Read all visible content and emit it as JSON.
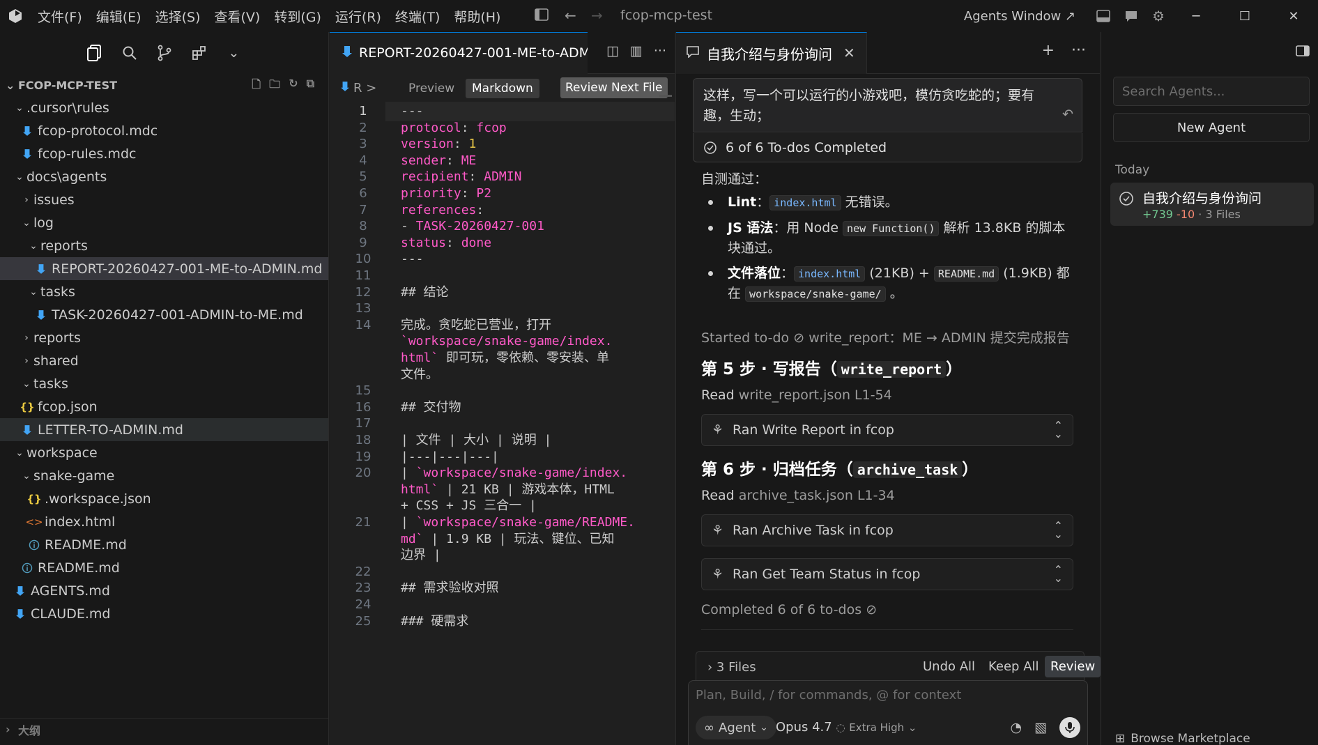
{
  "titlebar": {
    "menu": [
      "文件(F)",
      "编辑(E)",
      "选择(S)",
      "查看(V)",
      "转到(G)",
      "运行(R)",
      "终端(T)",
      "帮助(H)"
    ],
    "title": "fcop-mcp-test",
    "agents_window": "Agents Window ↗"
  },
  "explorer": {
    "root": "FCOP-MCP-TEST",
    "rows": [
      {
        "label": ".cursor\\rules",
        "indent": 1,
        "kind": "folder-open"
      },
      {
        "label": "fcop-protocol.mdc",
        "indent": 2,
        "kind": "md"
      },
      {
        "label": "fcop-rules.mdc",
        "indent": 2,
        "kind": "md"
      },
      {
        "label": "docs\\agents",
        "indent": 1,
        "kind": "folder-open"
      },
      {
        "label": "issues",
        "indent": 2,
        "kind": "folder"
      },
      {
        "label": "log",
        "indent": 2,
        "kind": "folder-open"
      },
      {
        "label": "reports",
        "indent": 3,
        "kind": "folder-open"
      },
      {
        "label": "REPORT-20260427-001-ME-to-ADMIN.md",
        "indent": 4,
        "kind": "md",
        "selected": true
      },
      {
        "label": "tasks",
        "indent": 3,
        "kind": "folder-open"
      },
      {
        "label": "TASK-20260427-001-ADMIN-to-ME.md",
        "indent": 4,
        "kind": "md"
      },
      {
        "label": "reports",
        "indent": 2,
        "kind": "folder"
      },
      {
        "label": "shared",
        "indent": 2,
        "kind": "folder"
      },
      {
        "label": "tasks",
        "indent": 2,
        "kind": "folder-open"
      },
      {
        "label": "fcop.json",
        "indent": 2,
        "kind": "json"
      },
      {
        "label": "LETTER-TO-ADMIN.md",
        "indent": 2,
        "kind": "md",
        "selected2": true
      },
      {
        "label": "workspace",
        "indent": 1,
        "kind": "folder-open"
      },
      {
        "label": "snake-game",
        "indent": 2,
        "kind": "folder-open"
      },
      {
        "label": ".workspace.json",
        "indent": 3,
        "kind": "json"
      },
      {
        "label": "index.html",
        "indent": 3,
        "kind": "html"
      },
      {
        "label": "README.md",
        "indent": 3,
        "kind": "info"
      },
      {
        "label": "README.md",
        "indent": 2,
        "kind": "info"
      },
      {
        "label": "AGENTS.md",
        "indent": 1,
        "kind": "md"
      },
      {
        "label": "CLAUDE.md",
        "indent": 1,
        "kind": "md"
      }
    ],
    "outline": "大纲"
  },
  "editor": {
    "tab_title": "REPORT-20260427-001-ME-to-ADMI",
    "crumb": "R >",
    "preview": "Preview",
    "markdown": "Markdown",
    "review_next": "Review Next File",
    "lines": [
      {
        "n": "1",
        "parts": [
          {
            "t": "---",
            "c": "plain"
          }
        ]
      },
      {
        "n": "2",
        "parts": [
          {
            "t": "protocol",
            "c": "k"
          },
          {
            "t": ": ",
            "c": "plain"
          },
          {
            "t": "fcop",
            "c": "k"
          }
        ]
      },
      {
        "n": "3",
        "parts": [
          {
            "t": "version",
            "c": "k"
          },
          {
            "t": ": ",
            "c": "plain"
          },
          {
            "t": "1",
            "c": "v"
          }
        ]
      },
      {
        "n": "4",
        "parts": [
          {
            "t": "sender",
            "c": "k"
          },
          {
            "t": ": ",
            "c": "plain"
          },
          {
            "t": "ME",
            "c": "k"
          }
        ]
      },
      {
        "n": "5",
        "parts": [
          {
            "t": "recipient",
            "c": "k"
          },
          {
            "t": ": ",
            "c": "plain"
          },
          {
            "t": "ADMIN",
            "c": "k"
          }
        ]
      },
      {
        "n": "6",
        "parts": [
          {
            "t": "priority",
            "c": "k"
          },
          {
            "t": ": ",
            "c": "plain"
          },
          {
            "t": "P2",
            "c": "k"
          }
        ]
      },
      {
        "n": "7",
        "parts": [
          {
            "t": "references",
            "c": "k"
          },
          {
            "t": ":",
            "c": "plain"
          }
        ]
      },
      {
        "n": "8",
        "parts": [
          {
            "t": "- ",
            "c": "plain"
          },
          {
            "t": "TASK-20260427-001",
            "c": "k"
          }
        ]
      },
      {
        "n": "9",
        "parts": [
          {
            "t": "status",
            "c": "k"
          },
          {
            "t": ": ",
            "c": "plain"
          },
          {
            "t": "done",
            "c": "k"
          }
        ]
      },
      {
        "n": "10",
        "parts": [
          {
            "t": "---",
            "c": "plain"
          }
        ]
      },
      {
        "n": "11",
        "parts": []
      },
      {
        "n": "12",
        "parts": [
          {
            "t": "## 结论",
            "c": "plain"
          }
        ]
      },
      {
        "n": "13",
        "parts": []
      },
      {
        "n": "14",
        "parts": [
          {
            "t": "完成。贪吃蛇已营业，打开",
            "c": "plain"
          }
        ]
      },
      {
        "n": "",
        "parts": [
          {
            "t": "`workspace/snake-game/index.",
            "c": "k"
          }
        ]
      },
      {
        "n": "",
        "parts": [
          {
            "t": "html`",
            "c": "k"
          },
          {
            "t": " 即可玩，零依赖、零安装、单",
            "c": "plain"
          }
        ]
      },
      {
        "n": "",
        "parts": [
          {
            "t": "文件。",
            "c": "plain"
          }
        ]
      },
      {
        "n": "15",
        "parts": []
      },
      {
        "n": "16",
        "parts": [
          {
            "t": "## 交付物",
            "c": "plain"
          }
        ]
      },
      {
        "n": "17",
        "parts": []
      },
      {
        "n": "18",
        "parts": [
          {
            "t": "| 文件 | 大小 | 说明 |",
            "c": "plain"
          }
        ]
      },
      {
        "n": "19",
        "parts": [
          {
            "t": "|---|---|---|",
            "c": "plain"
          }
        ]
      },
      {
        "n": "20",
        "parts": [
          {
            "t": "| ",
            "c": "plain"
          },
          {
            "t": "`workspace/snake-game/index.",
            "c": "k"
          }
        ]
      },
      {
        "n": "",
        "parts": [
          {
            "t": "html`",
            "c": "k"
          },
          {
            "t": " | 21 KB | 游戏本体，HTML",
            "c": "plain"
          }
        ]
      },
      {
        "n": "",
        "parts": [
          {
            "t": "+ CSS + JS 三合一 |",
            "c": "plain"
          }
        ]
      },
      {
        "n": "21",
        "parts": [
          {
            "t": "| ",
            "c": "plain"
          },
          {
            "t": "`workspace/snake-game/README.",
            "c": "k"
          }
        ]
      },
      {
        "n": "",
        "parts": [
          {
            "t": "md`",
            "c": "k"
          },
          {
            "t": " | 1.9 KB | 玩法、键位、已知",
            "c": "plain"
          }
        ]
      },
      {
        "n": "",
        "parts": [
          {
            "t": "边界 |",
            "c": "plain"
          }
        ]
      },
      {
        "n": "22",
        "parts": []
      },
      {
        "n": "23",
        "parts": [
          {
            "t": "## 需求验收对照",
            "c": "plain"
          }
        ]
      },
      {
        "n": "24",
        "parts": []
      },
      {
        "n": "25",
        "parts": [
          {
            "t": "### 硬需求",
            "c": "plain"
          }
        ]
      }
    ]
  },
  "chat": {
    "tab_title": "自我介绍与身份询问",
    "prompt_line1": "这样，写一个可以运行的小游戏吧，模仿贪吃蛇的；要有",
    "prompt_line2": "趣，生动；",
    "todos": "6 of 6 To-dos Completed",
    "selftest": "自测通过：",
    "b1_label": "Lint",
    "b1_sep": "：",
    "b1_code": "index.html",
    "b1_rest": " 无错误。",
    "b2_label": "JS 语法",
    "b2_pre": "：用 Node ",
    "b2_code": "new Function()",
    "b2_mid": " 解析 13.8KB 的脚本",
    "b2_line2": "块通过。",
    "b3_label": "文件落位",
    "b3_sep": "：",
    "b3_code1": "index.html",
    "b3_mid": " (21KB) + ",
    "b3_code2": "README.md",
    "b3_end": " (1.9KB) 都",
    "b3_line2_pre": "在 ",
    "b3_code3": "workspace/snake-game/",
    "b3_line2_end": " 。",
    "started_todo": "Started to-do",
    "started_todo_text": "write_report：ME → ADMIN 提交完成报告",
    "step5_pre": "第 5 步 · 写报告（",
    "step5_code": "write_report",
    "step5_post": "）",
    "read1_label": "Read",
    "read1_file": "write_report.json L1-54",
    "tool1": "Ran Write Report in fcop",
    "step6_pre": "第 6 步 · 归档任务（",
    "step6_code": "archive_task",
    "step6_post": "）",
    "read2_label": "Read",
    "read2_file": "archive_task.json L1-34",
    "tool2": "Ran Archive Task in fcop",
    "tool3": "Ran Get Team Status in fcop",
    "completed": "Completed 6 of 6 to-dos",
    "files": "3 Files",
    "undo_all": "Undo All",
    "keep_all": "Keep All",
    "review": "Review",
    "composer_placeholder": "Plan, Build, / for commands, @ for context",
    "agent_mode": "Agent",
    "model": "Opus 4.7",
    "effort": "Extra High"
  },
  "agents_panel": {
    "search_placeholder": "Search Agents...",
    "new_agent": "New Agent",
    "today": "Today",
    "item_name": "自我介绍与身份询问",
    "item_add": "+739",
    "item_del": "-10",
    "item_files": "· 3 Files",
    "browse": "Browse Marketplace"
  },
  "colors": {
    "accent": "#0078d4",
    "yaml_key": "#ff5ac8",
    "yaml_number": "#e7c547",
    "added": "#73c991",
    "removed": "#f48771"
  }
}
